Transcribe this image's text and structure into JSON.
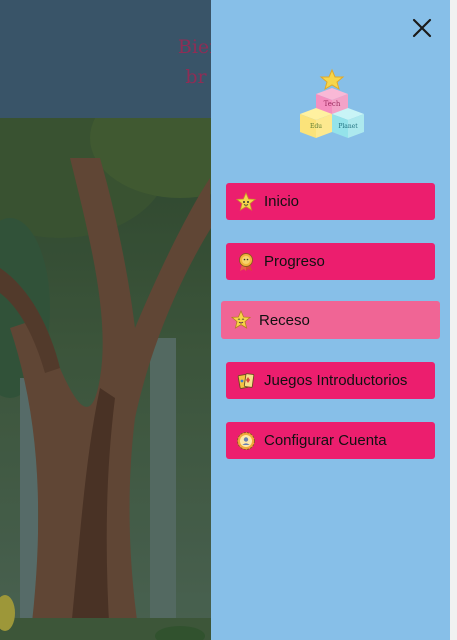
{
  "page": {
    "welcome_line1": "Bienv",
    "welcome_line2": "br"
  },
  "drawer": {
    "logo": {
      "word_top": "Tech",
      "word_left": "Edu",
      "word_right": "Planet"
    },
    "menu": [
      {
        "label": "Inicio",
        "icon": "star-face-icon",
        "active": false
      },
      {
        "label": "Progreso",
        "icon": "award-badge-icon",
        "active": false
      },
      {
        "label": "Receso",
        "icon": "happy-star-icon",
        "active": true
      },
      {
        "label": "Juegos Introductorios",
        "icon": "game-cards-icon",
        "active": false
      },
      {
        "label": "Configurar Cuenta",
        "icon": "user-gear-icon",
        "active": false
      }
    ]
  },
  "colors": {
    "drawer_bg": "#87bfe8",
    "menu_item": "#ec1e6e",
    "menu_item_active": "#f06595",
    "header": "#4a6c86",
    "welcome_text": "#b63a6d"
  }
}
